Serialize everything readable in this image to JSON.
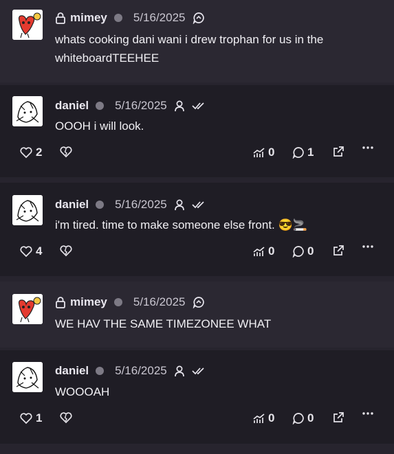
{
  "posts": [
    {
      "author": "mimey",
      "date": "5/16/2025",
      "text": "whats cooking dani wani i drew trophan for us in the whiteboardTEEHEE"
    },
    {
      "author": "daniel",
      "date": "5/16/2025",
      "text": "OOOH i will look.",
      "likes": "2",
      "boosts": "0",
      "replies": "1"
    },
    {
      "author": "daniel",
      "date": "5/16/2025",
      "text": "i'm tired. time to make someone else front.",
      "emoji": "😎🚬",
      "likes": "4",
      "boosts": "0",
      "replies": "0"
    },
    {
      "author": "mimey",
      "date": "5/16/2025",
      "text": "WE HAV THE SAME TIMEZONEE WHAT"
    },
    {
      "author": "daniel",
      "date": "5/16/2025",
      "text": "WOOOAH",
      "likes": "1",
      "boosts": "0",
      "replies": "0"
    }
  ],
  "icons": {
    "lock": "lock-icon",
    "status_dot": "status-dot",
    "reply_chat": "chat-bubble-icon",
    "person": "person-icon",
    "double_check": "double-check-icon",
    "heart": "heart-icon",
    "heart_break": "broken-heart-icon",
    "boost": "boost-chart-icon",
    "comment": "comment-icon",
    "share": "external-link-icon",
    "more": "more-icon"
  },
  "colors": {
    "background": "#27242e",
    "mimey_post": "#2b2832",
    "daniel_post": "#1f1d25",
    "text": "#ecebf0",
    "status": "#7d7a85"
  }
}
